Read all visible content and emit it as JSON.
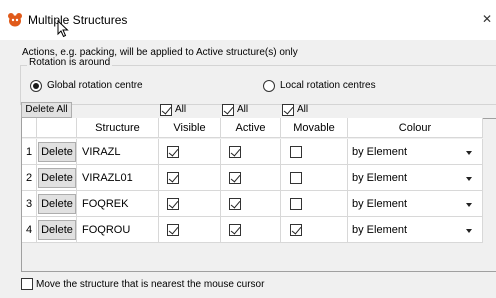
{
  "window": {
    "title": "Multiple Structures",
    "close_glyph": "✕",
    "accent": "#e05a1a"
  },
  "description": "Actions, e.g. packing, will be applied to Active structure(s) only",
  "rotation_group": {
    "legend": "Rotation is around",
    "options": [
      {
        "label": "Global rotation centre",
        "selected": true
      },
      {
        "label": "Local rotation centres",
        "selected": false
      }
    ]
  },
  "toolbar": {
    "delete_all_label": "Delete All",
    "visible_all": {
      "label": "All",
      "checked": true
    },
    "active_all": {
      "label": "All",
      "checked": true
    },
    "movable_all": {
      "label": "All",
      "checked": true
    }
  },
  "table": {
    "columns": [
      "Structure",
      "Visible",
      "Active",
      "Movable",
      "Colour"
    ],
    "delete_label": "Delete",
    "rows": [
      {
        "index": "1",
        "structure": "VIRAZL",
        "visible": true,
        "active": true,
        "movable": false,
        "colour": "by Element"
      },
      {
        "index": "2",
        "structure": "VIRAZL01",
        "visible": true,
        "active": true,
        "movable": false,
        "colour": "by Element"
      },
      {
        "index": "3",
        "structure": "FOQREK",
        "visible": true,
        "active": true,
        "movable": false,
        "colour": "by Element"
      },
      {
        "index": "4",
        "structure": "FOQROU",
        "visible": true,
        "active": true,
        "movable": true,
        "colour": "by Element"
      }
    ]
  },
  "footer": {
    "label": "Move the structure that is nearest the mouse cursor",
    "checked": false
  }
}
